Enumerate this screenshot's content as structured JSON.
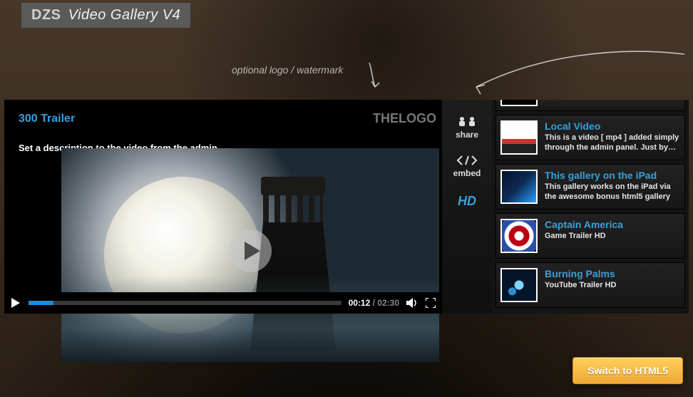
{
  "header": {
    "brand": "DZS",
    "product": "Video Gallery V4"
  },
  "annotation": {
    "watermark_note": "optional logo / watermark"
  },
  "player": {
    "title": "300 Trailer",
    "description": "Set a description to the video from the admin.",
    "logo_text": "THELOGO",
    "time_current": "00:12",
    "time_separator": " / ",
    "time_duration": "02:30",
    "progress_pct": 8,
    "actions": {
      "share": "share",
      "embed": "embed",
      "hd": "HD"
    }
  },
  "playlist": [
    {
      "title": "Local Video",
      "desc": "This is a video [ mp4 ] added simply through the admin panel. Just by clicking",
      "thumb": "th-car"
    },
    {
      "title": "This gallery on the iPad",
      "desc": "This gallery works on the iPad via the awesome bonus html5 gallery",
      "thumb": "th-ipad"
    },
    {
      "title": "Captain America",
      "desc": "Game Trailer HD",
      "thumb": "th-cap"
    },
    {
      "title": "Burning Palms",
      "desc": "YouTube Trailer HD",
      "thumb": "th-burn"
    }
  ],
  "footer": {
    "switch_label": "Switch to HTML5"
  },
  "colors": {
    "accent": "#3aa0d8",
    "seek": "#1e8bd4",
    "cta_top": "#ffcf5a",
    "cta_bottom": "#f0a836"
  }
}
